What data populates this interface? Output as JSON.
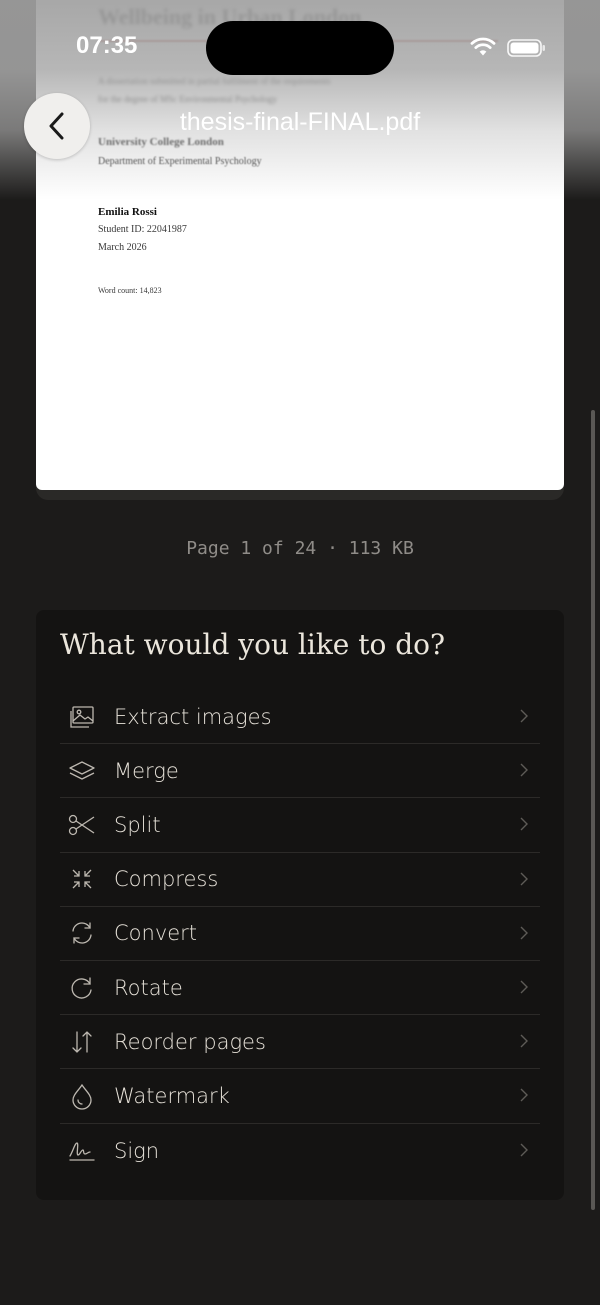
{
  "status_bar": {
    "time": "07:35"
  },
  "header": {
    "title": "thesis-final-FINAL.pdf"
  },
  "document": {
    "title_partial": "Wellbeing in Urban London",
    "submission_line_1": "A dissertation submitted in partial fulfilment of the requirements",
    "submission_line_2": "for the degree of MSc Environmental Psychology",
    "institution": "University College London",
    "department": "Department of Experimental Psychology",
    "author": "Emilia Rossi",
    "student_id": "Student ID: 22041987",
    "date": "March 2026",
    "word_count": "Word count: 14,823"
  },
  "page_meta": "Page 1 of 24 · 113 KB",
  "actions": {
    "heading": "What would you like to do?",
    "items": [
      {
        "label": "Extract images",
        "icon": "image-icon"
      },
      {
        "label": "Merge",
        "icon": "layers-icon"
      },
      {
        "label": "Split",
        "icon": "scissors-icon"
      },
      {
        "label": "Compress",
        "icon": "compress-icon"
      },
      {
        "label": "Convert",
        "icon": "convert-icon"
      },
      {
        "label": "Rotate",
        "icon": "rotate-icon"
      },
      {
        "label": "Reorder pages",
        "icon": "reorder-icon"
      },
      {
        "label": "Watermark",
        "icon": "drop-icon"
      },
      {
        "label": "Sign",
        "icon": "signature-icon"
      }
    ]
  },
  "colors": {
    "background": "#1c1b1a",
    "card": "#141312",
    "accent_rule": "#b44a44"
  }
}
